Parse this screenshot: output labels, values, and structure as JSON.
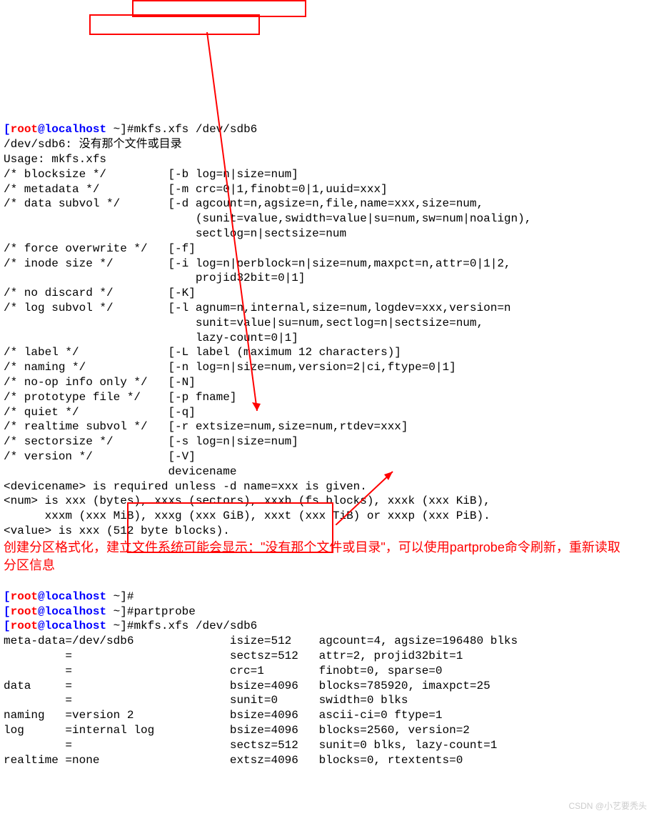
{
  "prompt": {
    "user": "root",
    "at": "@",
    "host": "localhost",
    "tilde": " ~",
    "hash": "]#"
  },
  "cmd1": "mkfs.xfs /dev/sdb6",
  "err1": "/dev/sdb6: 没有那个文件或目录",
  "usage": "Usage: mkfs.xfs",
  "opt": {
    "l1": "/* blocksize */         [-b log=n|size=num]",
    "l2": "/* metadata */          [-m crc=0|1,finobt=0|1,uuid=xxx]",
    "l3": "/* data subvol */       [-d agcount=n,agsize=n,file,name=xxx,size=num,",
    "l4": "                            (sunit=value,swidth=value|su=num,sw=num|noalign),",
    "l5": "                            sectlog=n|sectsize=num",
    "l6": "/* force overwrite */   [-f]",
    "l7": "/* inode size */        [-i log=n|perblock=n|size=num,maxpct=n,attr=0|1|2,",
    "l8": "                            projid32bit=0|1]",
    "l9": "/* no discard */        [-K]",
    "l10": "/* log subvol */        [-l agnum=n,internal,size=num,logdev=xxx,version=n",
    "l11": "                            sunit=value|su=num,sectlog=n|sectsize=num,",
    "l12": "                            lazy-count=0|1]",
    "l13": "/* label */             [-L label (maximum 12 characters)]",
    "l14": "/* naming */            [-n log=n|size=num,version=2|ci,ftype=0|1]",
    "l15": "/* no-op info only */   [-N]",
    "l16": "/* prototype file */    [-p fname]",
    "l17": "/* quiet */             [-q]",
    "l18": "/* realtime subvol */   [-r extsize=num,size=num,rtdev=xxx]",
    "l19": "/* sectorsize */        [-s log=n|size=num]",
    "l20": "/* version */           [-V]",
    "l21": "                        devicename"
  },
  "notes": {
    "n1": "<devicename> is required unless -d name=xxx is given.",
    "n2": "<num> is xxx (bytes), xxxs (sectors), xxxb (fs blocks), xxxk (xxx KiB),",
    "n3": "      xxxm (xxx MiB), xxxg (xxx GiB), xxxt (xxx TiB) or xxxp (xxx PiB).",
    "n4": "<value> is xxx (512 byte blocks)."
  },
  "annotation": "创建分区格式化，建立文件系统可能会显示：\"没有那个文件或目录\"，可以使用partprobe命令刷新，重新读取分区信息",
  "cmd2": "",
  "cmd3": "partprobe",
  "cmd4": "mkfs.xfs /dev/sdb6",
  "out": {
    "o1": "meta-data=/dev/sdb6              isize=512    agcount=4, agsize=196480 blks",
    "o2": "         =                       sectsz=512   attr=2, projid32bit=1",
    "o3": "         =                       crc=1        finobt=0, sparse=0",
    "o4": "data     =                       bsize=4096   blocks=785920, imaxpct=25",
    "o5": "         =                       sunit=0      swidth=0 blks",
    "o6": "naming   =version 2              bsize=4096   ascii-ci=0 ftype=1",
    "o7": "log      =internal log           bsize=4096   blocks=2560, version=2",
    "o8": "         =                       sectsz=512   sunit=0 blks, lazy-count=1",
    "o9": "realtime =none                   extsz=4096   blocks=0, rtextents=0"
  },
  "watermark": "CSDN @小艺要秃头"
}
